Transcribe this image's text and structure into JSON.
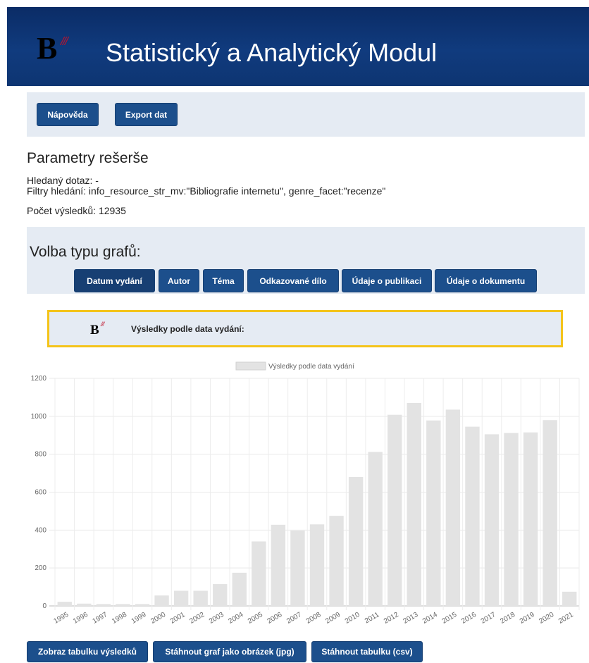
{
  "header": {
    "logo_letter": "B",
    "logo_marks": "///",
    "title": "Statistický a Analytický Modul"
  },
  "toolbar": {
    "help_label": "Nápověda",
    "export_label": "Export dat"
  },
  "params": {
    "heading": "Parametry rešerše",
    "query": "Hledaný dotaz: -",
    "filters": "Filtry hledání: info_resource_str_mv:\"Bibliografie internetu\", genre_facet:\"recenze\"",
    "count": "Počet výsledků: 12935"
  },
  "graph_type": {
    "heading": "Volba typu grafů:",
    "tabs": [
      "Datum vydání",
      "Autor",
      "Téma",
      "Odkazované dílo",
      "Údaje o publikaci",
      "Údaje o dokumentu"
    ],
    "active_tab": "Datum vydání"
  },
  "result_header": {
    "logo_letter": "B",
    "logo_marks": "///",
    "label": "Výsledky podle data vydání:"
  },
  "actions": {
    "show_table": "Zobraz tabulku výsledků",
    "download_image": "Stáhnout graf jako obrázek (jpg)",
    "download_csv": "Stáhnout tabulku (csv)"
  },
  "colors": {
    "header_bg": "#0e3572",
    "button_bg": "#1c4f8c",
    "panel_bg": "#e5ebf3",
    "highlight_border": "#f4c41a",
    "bar_fill": "#e3e3e3"
  },
  "chart_data": {
    "type": "bar",
    "legend": "Výsledky podle data vydání",
    "legend_position": "top",
    "categories": [
      "1995",
      "1996",
      "1997",
      "1998",
      "1999",
      "2000",
      "2001",
      "2002",
      "2003",
      "2004",
      "2005",
      "2006",
      "2007",
      "2008",
      "2009",
      "2010",
      "2011",
      "2012",
      "2013",
      "2014",
      "2015",
      "2016",
      "2017",
      "2018",
      "2019",
      "2020",
      "2021"
    ],
    "series": [
      {
        "name": "Výsledky podle data vydání",
        "values": [
          22,
          12,
          10,
          10,
          10,
          55,
          80,
          80,
          115,
          175,
          340,
          428,
          397,
          430,
          475,
          680,
          812,
          1008,
          1070,
          978,
          1035,
          945,
          905,
          912,
          915,
          980,
          75
        ]
      }
    ],
    "ylim": [
      0,
      1200
    ],
    "yticks": [
      0,
      200,
      400,
      600,
      800,
      1000,
      1200
    ],
    "grid": true
  }
}
